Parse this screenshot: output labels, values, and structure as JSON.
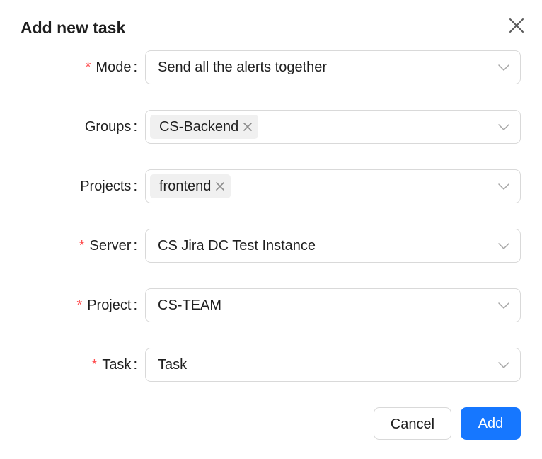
{
  "dialog": {
    "title": "Add new task"
  },
  "form": {
    "fields": [
      {
        "label": "Mode",
        "required": true,
        "value": "Send all the alerts together"
      },
      {
        "label": "Groups",
        "required": false,
        "tags": [
          "CS-Backend"
        ]
      },
      {
        "label": "Projects",
        "required": false,
        "tags": [
          "frontend"
        ]
      },
      {
        "label": "Server",
        "required": true,
        "value": "CS Jira DC Test Instance"
      },
      {
        "label": "Project",
        "required": true,
        "value": "CS-TEAM"
      },
      {
        "label": "Task",
        "required": true,
        "value": "Task"
      }
    ],
    "required_mark": "*",
    "colon": ":"
  },
  "footer": {
    "cancel_label": "Cancel",
    "add_label": "Add"
  },
  "colors": {
    "primary": "#1677ff",
    "required": "#ff4d4f",
    "border": "#d9d9d9",
    "tag_bg": "#f0f0f0"
  }
}
